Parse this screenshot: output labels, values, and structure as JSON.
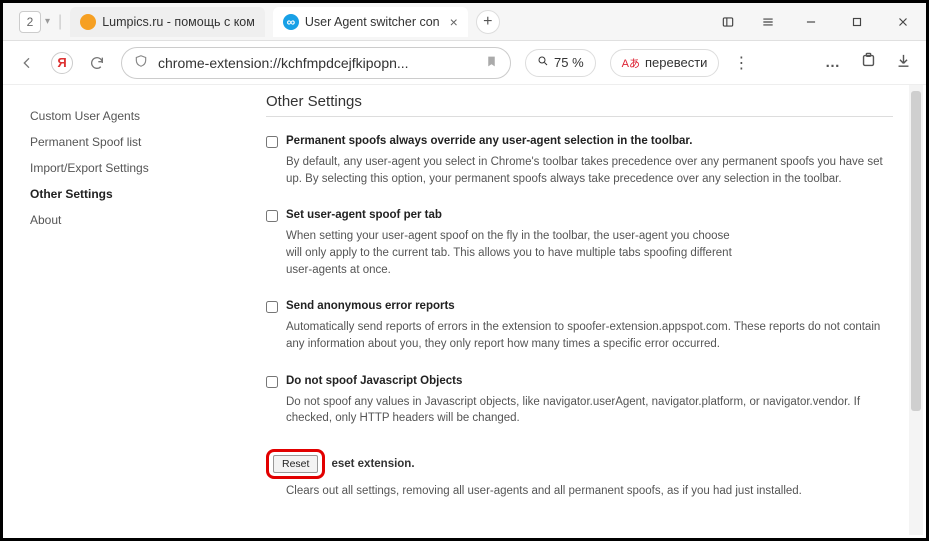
{
  "tabbar": {
    "tab_count": "2",
    "tabs": [
      {
        "label": "Lumpics.ru - помощь с ком"
      },
      {
        "label": "User Agent switcher con"
      }
    ]
  },
  "addr": {
    "url": "chrome-extension://kchfmpdcejfkipopn...",
    "zoom": "75 %",
    "translate": "перевести"
  },
  "sidebar": {
    "items": [
      "Custom User Agents",
      "Permanent Spoof list",
      "Import/Export Settings",
      "Other Settings",
      "About"
    ],
    "active_index": 3
  },
  "content": {
    "heading": "Other Settings",
    "settings": [
      {
        "label": "Permanent spoofs always override any user-agent selection in the toolbar.",
        "desc": "By default, any user-agent you select in Chrome's toolbar takes precedence over any permanent spoofs you have set up. By selecting this option, your permanent spoofs always take precedence over any selection in the toolbar.",
        "desc_narrow": false
      },
      {
        "label": "Set user-agent spoof per tab",
        "desc": "When setting your user-agent spoof on the fly in the toolbar, the user-agent you choose will only apply to the current tab. This allows you to have multiple tabs spoofing different user-agents at once.",
        "desc_narrow": true
      },
      {
        "label": "Send anonymous error reports",
        "desc": "Automatically send reports of errors in the extension to spoofer-extension.appspot.com. These reports do not contain any information about you, they only report how many times a specific error occurred.",
        "desc_narrow": false
      },
      {
        "label": "Do not spoof Javascript Objects",
        "desc": "Do not spoof any values in Javascript objects, like navigator.userAgent, navigator.platform, or navigator.vendor. If checked, only HTTP headers will be changed.",
        "desc_narrow": false
      }
    ],
    "reset": {
      "button": "Reset",
      "label": "eset extension.",
      "desc": "Clears out all settings, removing all user-agents and all permanent spoofs, as if you had just installed."
    }
  }
}
